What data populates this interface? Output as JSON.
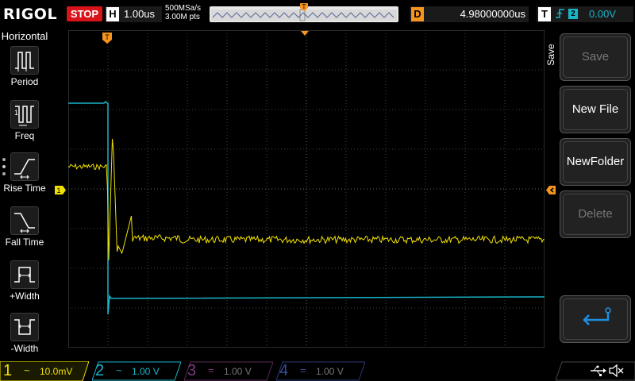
{
  "topbar": {
    "logo": "RIGOL",
    "run_state": "STOP",
    "h_label": "H",
    "timebase": "1.00us",
    "sample_rate": "500MSa/s",
    "memory_depth": "3.00M pts",
    "d_label": "D",
    "delay": "4.98000000us",
    "t_label": "T",
    "trigger_edge_icon": "rising-edge-icon",
    "trigger_source": "2",
    "trigger_level": "0.00V"
  },
  "left_menu": {
    "title": "Horizontal",
    "items": [
      {
        "label": "Period",
        "icon": "period-icon"
      },
      {
        "label": "Freq",
        "icon": "frequency-icon"
      },
      {
        "label": "Rise Time",
        "icon": "rise-time-icon"
      },
      {
        "label": "Fall Time",
        "icon": "fall-time-icon"
      },
      {
        "label": "+Width",
        "icon": "positive-width-icon"
      },
      {
        "label": "-Width",
        "icon": "negative-width-icon"
      }
    ]
  },
  "right_menu": {
    "title": "Save",
    "buttons": [
      {
        "label": "Save",
        "enabled": false
      },
      {
        "label": "New File",
        "enabled": true
      },
      {
        "label": "NewFolder",
        "enabled": true
      },
      {
        "label": "Delete",
        "enabled": false
      }
    ],
    "back_icon": "return-arrow-icon"
  },
  "channels": [
    {
      "num": "1",
      "coupling_icon": "ac-coupling-icon",
      "scale": "10.0mV",
      "active": true,
      "color": "#f0e000"
    },
    {
      "num": "2",
      "coupling_icon": "ac-coupling-icon",
      "scale": "1.00 V",
      "active": true,
      "color": "#19b5c8"
    },
    {
      "num": "3",
      "coupling_icon": "dc-coupling-icon",
      "scale": "1.00 V",
      "active": false,
      "color": "#e040e0"
    },
    {
      "num": "4",
      "coupling_icon": "dc-coupling-icon",
      "scale": "1.00 V",
      "active": false,
      "color": "#3060e0"
    }
  ],
  "status_icons": [
    "usb-icon",
    "speaker-mute-icon"
  ],
  "markers": {
    "trigger_position": "T",
    "ch1_marker": "1"
  },
  "colors": {
    "ch1": "#f0e000",
    "ch2": "#19b5c8",
    "trigger": "#f7941d",
    "stop": "#d8141a"
  }
}
